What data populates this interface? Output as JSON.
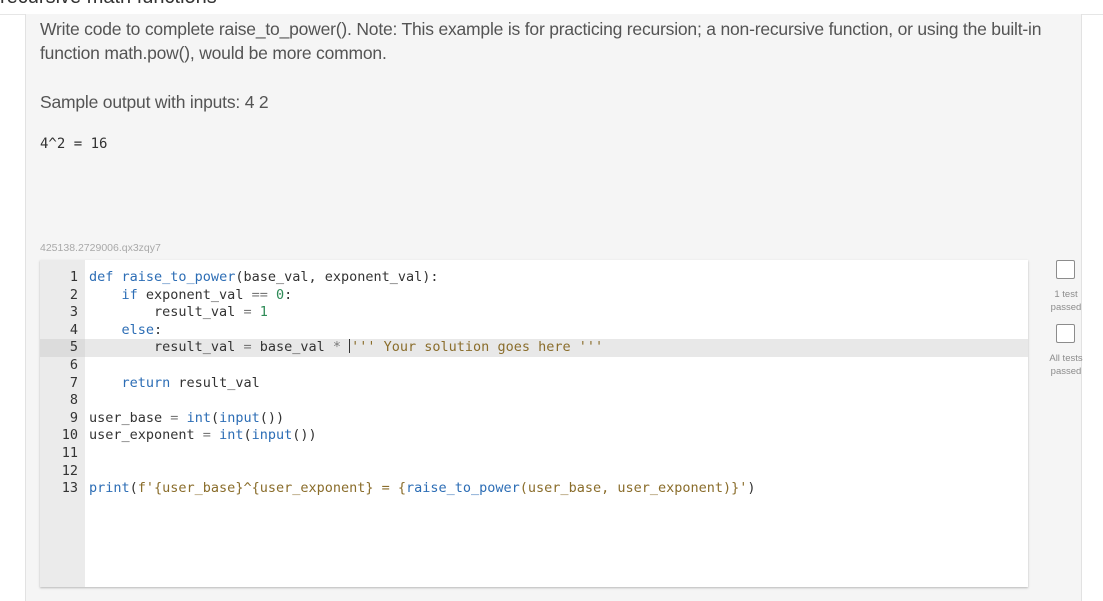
{
  "page": {
    "partial_header": "recursive math functions"
  },
  "instructions": {
    "description": "Write code to complete raise_to_power(). Note: This example is for practicing recursion; a non-recursive function, or using the built-in function math.pow(), would be more common.",
    "sample_label": "Sample output with inputs: 4 2",
    "sample_output": "4^2 = 16",
    "question_id": "425138.2729006.qx3zqy7"
  },
  "editor": {
    "active_line": 5,
    "lines": [
      {
        "n": "1",
        "text": "def raise_to_power(base_val, exponent_val):"
      },
      {
        "n": "2",
        "text": "    if exponent_val == 0:"
      },
      {
        "n": "3",
        "text": "        result_val = 1"
      },
      {
        "n": "4",
        "text": "    else:"
      },
      {
        "n": "5",
        "text": "        result_val = base_val * ''' Your solution goes here '''"
      },
      {
        "n": "6",
        "text": ""
      },
      {
        "n": "7",
        "text": "    return result_val"
      },
      {
        "n": "8",
        "text": ""
      },
      {
        "n": "9",
        "text": "user_base = int(input())"
      },
      {
        "n": "10",
        "text": "user_exponent = int(input())"
      },
      {
        "n": "11",
        "text": ""
      },
      {
        "n": "12",
        "text": ""
      },
      {
        "n": "13",
        "text": "print(f'{user_base}^{user_exponent} = {raise_to_power(user_base, user_exponent)}')"
      }
    ]
  },
  "status": {
    "test1_label": "1 test passed",
    "test1_line1": "1 test",
    "test1_line2": "passed",
    "all_label": "All tests passed",
    "all_line1": "All tests",
    "all_line2": "passed"
  },
  "colors": {
    "keyword": "#2c6db5",
    "number": "#2e8b57",
    "string": "#8a6d2b",
    "card_bg": "#f5f5f5",
    "gutter_bg": "#ebebeb",
    "active_line_bg": "#e8e8e8"
  }
}
